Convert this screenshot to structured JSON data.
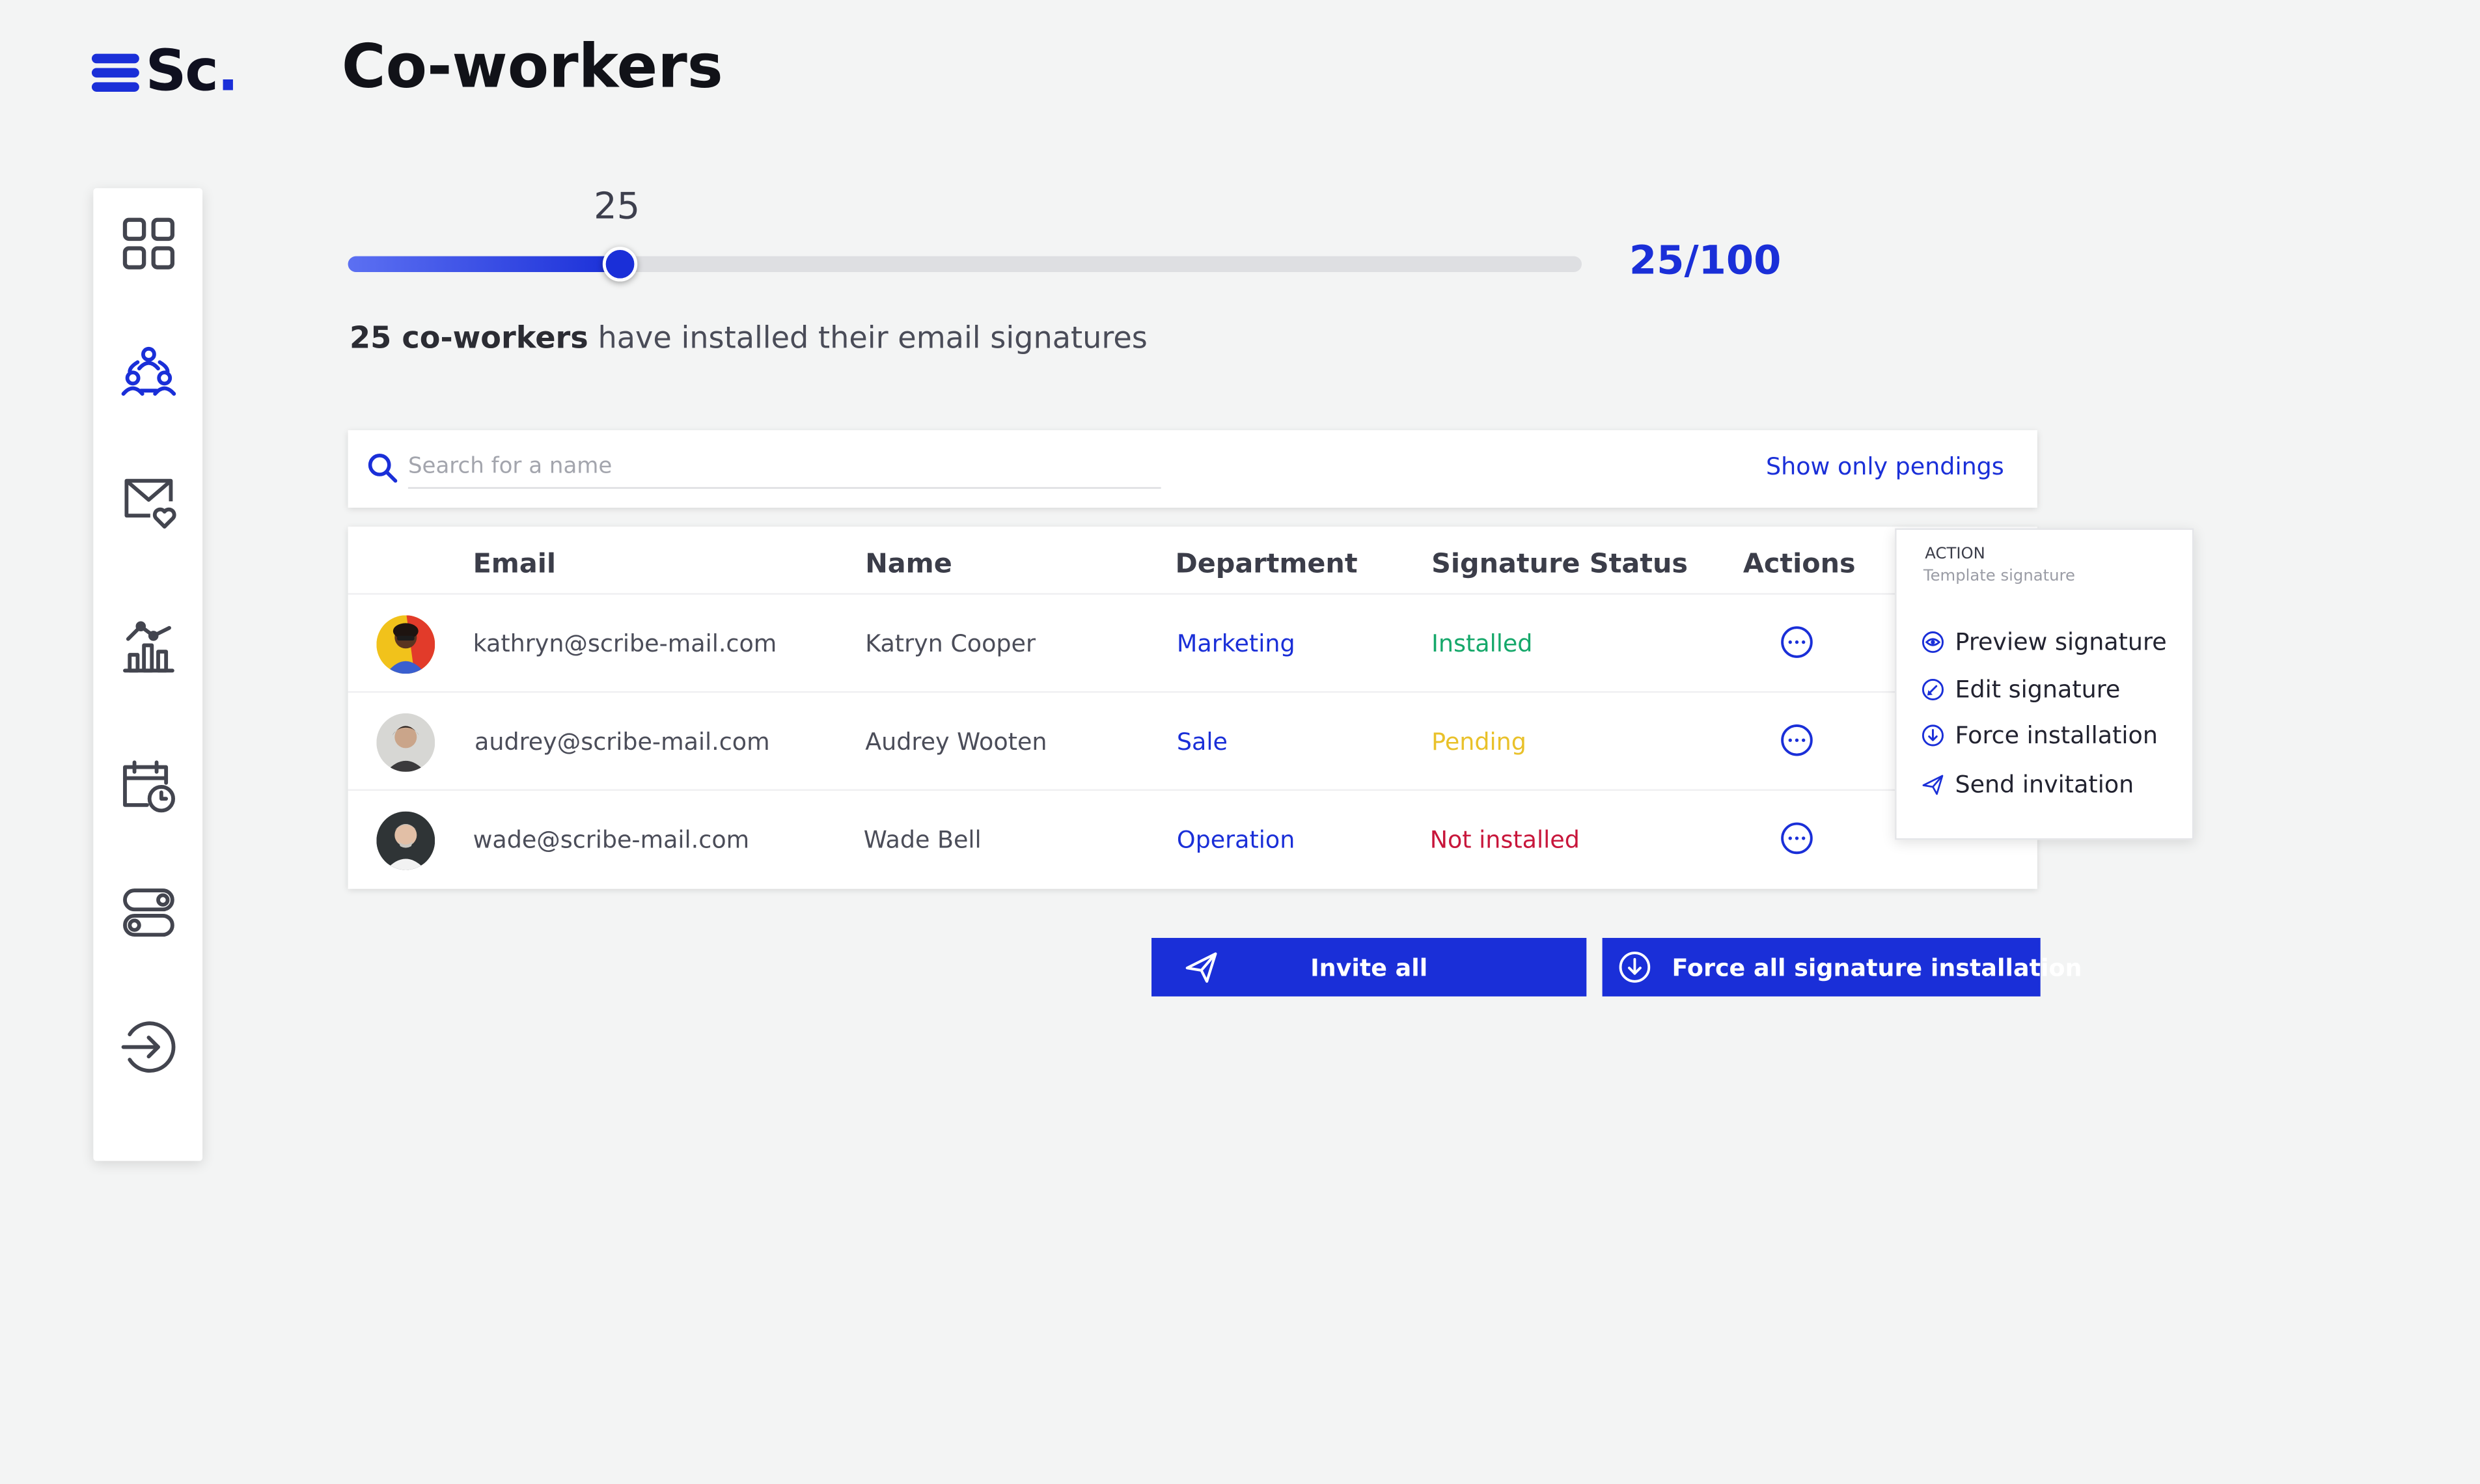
{
  "app": {
    "logo_text": "Sc",
    "logo_dot": ".",
    "page_title": "Co-workers",
    "brand_color": "#1a2fd8"
  },
  "sidebar": {
    "items": [
      {
        "icon": "dashboard-grid-icon"
      },
      {
        "icon": "co-workers-icon",
        "active": true
      },
      {
        "icon": "mail-heart-icon"
      },
      {
        "icon": "analytics-chart-icon"
      },
      {
        "icon": "calendar-clock-icon"
      },
      {
        "icon": "toggles-settings-icon"
      },
      {
        "icon": "logout-arrow-icon"
      }
    ]
  },
  "progress": {
    "slider_value": "25",
    "ratio": "25/100",
    "fraction": 0.22,
    "summary_bold": "25 co-workers",
    "summary_rest": " have installed their email signatures"
  },
  "search": {
    "placeholder": "Search for a name",
    "value": "",
    "show_pendings": "Show only pendings"
  },
  "table": {
    "headers": {
      "email": "Email",
      "name": "Name",
      "department": "Department",
      "status": "Signature Status",
      "actions": "Actions"
    },
    "rows": [
      {
        "email": "kathryn@scribe-mail.com",
        "name": "Katryn Cooper",
        "department": "Marketing",
        "status": "Installed",
        "status_color": "#15a86a"
      },
      {
        "email": "audrey@scribe-mail.com",
        "name": "Audrey Wooten",
        "department": "Sale",
        "status": "Pending",
        "status_color": "#e9c12a"
      },
      {
        "email": "wade@scribe-mail.com",
        "name": "Wade Bell",
        "department": "Operation",
        "status": "Not installed",
        "status_color": "#c8163b"
      }
    ]
  },
  "action_menu": {
    "title": "ACTION",
    "subtitle": "Template signature",
    "items": [
      {
        "label": "Preview signature",
        "icon": "eye-icon"
      },
      {
        "label": "Edit signature",
        "icon": "pencil-icon"
      },
      {
        "label": "Force installation",
        "icon": "download-circle-icon"
      },
      {
        "label": "Send invitation",
        "icon": "paper-plane-icon"
      }
    ]
  },
  "buttons": {
    "invite_all": "Invite all",
    "force_all": "Force all signature installation"
  }
}
